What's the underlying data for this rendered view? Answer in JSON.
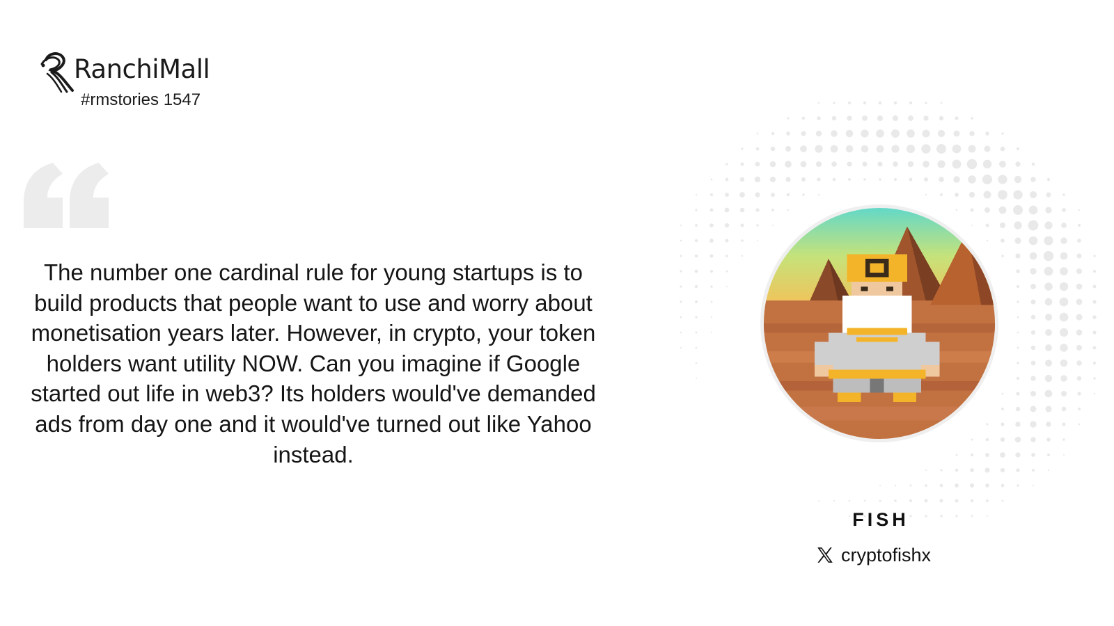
{
  "brand": {
    "name": "RanchiMall",
    "tag": "#rmstories 1547",
    "logo_icon": "ranchimall-logo-icon"
  },
  "quote": {
    "icon": "quotation-mark-icon",
    "text": "The number one cardinal rule for young startups is to build products that people want to use and worry about monetisation years later. However, in crypto, your token holders want utility NOW. Can you imagine if Google started out life in web3? Its holders would've demanded ads from day one and it would've turned out like Yahoo instead."
  },
  "author": {
    "name": "FISH",
    "social_icon": "x-twitter-icon",
    "handle": "cryptofishx",
    "avatar": "pixel-art-avatar"
  },
  "colors": {
    "text": "#151515",
    "quote_mark": "#ececec",
    "dots": "#e9e9e9"
  }
}
